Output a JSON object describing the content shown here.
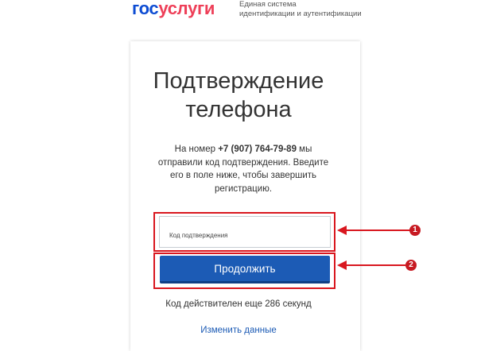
{
  "header": {
    "logo_part1": "гос",
    "logo_part2": "услуги",
    "tagline_line1": "Единая система",
    "tagline_line2": "идентификации и аутентификации"
  },
  "card": {
    "title_line1": "Подтверждение",
    "title_line2": "телефона",
    "desc_prefix": "На номер ",
    "phone": "+7 (907) 764-79-89",
    "desc_suffix": " мы отправили код подтверждения. Введите его в поле ниже, чтобы завершить регистрацию.",
    "code_field_placeholder": "Код подтверждения",
    "continue_label": "Продолжить",
    "timer_text": "Код действителен еще 286 секунд",
    "change_data_label": "Изменить данные"
  },
  "annotations": {
    "marker_1": "1",
    "marker_2": "2"
  },
  "colors": {
    "brand_blue": "#0d4cd3",
    "brand_red": "#ee3f58",
    "button_blue": "#1c5bb5",
    "highlight_red": "#d9171f"
  }
}
